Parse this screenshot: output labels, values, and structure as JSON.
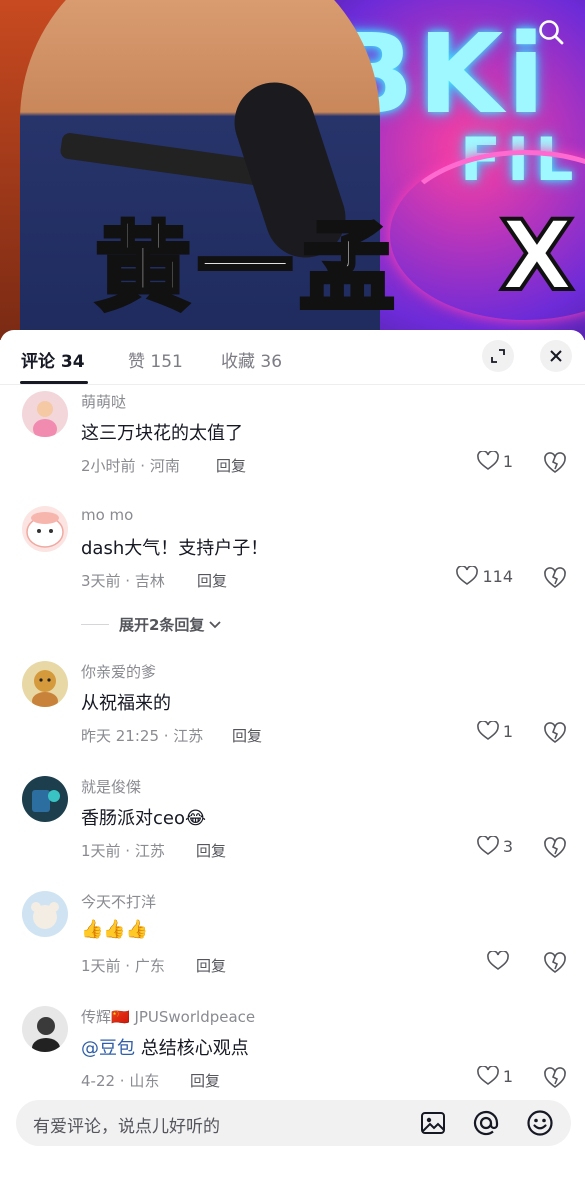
{
  "video": {
    "neon_big": "BKi",
    "neon_small": "FIL",
    "caption": "黄一孟",
    "caption_x": "X"
  },
  "tabs": [
    {
      "label": "评论 34",
      "active": true
    },
    {
      "label": "赞 151",
      "active": false
    },
    {
      "label": "收藏 36",
      "active": false
    }
  ],
  "comments": [
    {
      "user": "萌萌哒",
      "text": "这三万块花的太值了",
      "meta": "2小时前 · 河南",
      "reply": "回复",
      "likes": "1",
      "avatar_color": "#f3d6da"
    },
    {
      "user": "mo mo",
      "text": "dash大气！支持户子！",
      "meta": "3天前 · 吉林",
      "reply": "回复",
      "likes": "114",
      "expand": "展开2条回复",
      "avatar_color": "#fbe4e1"
    },
    {
      "user": "你亲爱的爹",
      "text": "从祝福来的",
      "meta": "昨天 21:25 · 江苏",
      "reply": "回复",
      "likes": "1",
      "avatar_color": "#e8d8a6"
    },
    {
      "user": "就是俊傑",
      "text": "香肠派对ceo😂",
      "meta": "1天前 · 江苏",
      "reply": "回复",
      "likes": "3",
      "avatar_color": "#1c3e4d"
    },
    {
      "user": "今天不打洋",
      "text": "👍👍👍",
      "meta": "1天前 · 广东",
      "reply": "回复",
      "likes": "",
      "avatar_color": "#cfe3f3"
    },
    {
      "user": "传辉🇨🇳 JPUSworldpeace",
      "mention": "@豆包",
      "text": "总结核心观点",
      "meta": "4-22 · 山东",
      "reply": "回复",
      "likes": "1",
      "avatar_color": "#e7e7e7"
    }
  ],
  "input": {
    "placeholder": "有爱评论，说点儿好听的"
  },
  "icons": [
    "search-icon",
    "expand-icon",
    "close-icon",
    "heart-icon",
    "broken-heart-icon",
    "chevron-down-icon",
    "image-icon",
    "at-icon",
    "emoji-icon"
  ]
}
